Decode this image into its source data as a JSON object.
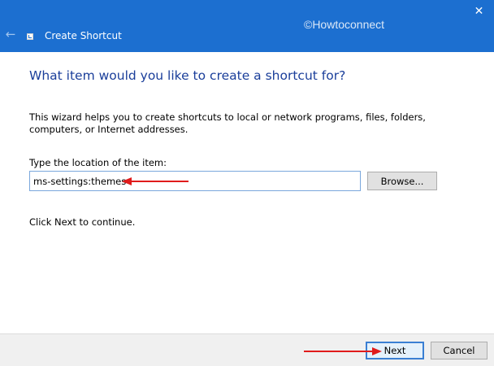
{
  "window": {
    "title": "Create Shortcut",
    "watermark": "©Howtoconnect",
    "back_glyph": "←",
    "close_glyph": "✕"
  },
  "content": {
    "heading": "What item would you like to create a shortcut for?",
    "description": "This wizard helps you to create shortcuts to local or network programs, files, folders, computers, or Internet addresses.",
    "location_label": "Type the location of the item:",
    "location_value": "ms-settings:themes",
    "browse_label": "Browse...",
    "continue_text": "Click Next to continue."
  },
  "footer": {
    "next_label": "Next",
    "cancel_label": "Cancel"
  },
  "colors": {
    "titlebar": "#1c6fd0",
    "heading": "#1a3e9a",
    "annotation_arrow": "#e01b1b"
  },
  "icons": [
    "back-arrow-icon",
    "shortcut-app-icon",
    "close-icon"
  ]
}
